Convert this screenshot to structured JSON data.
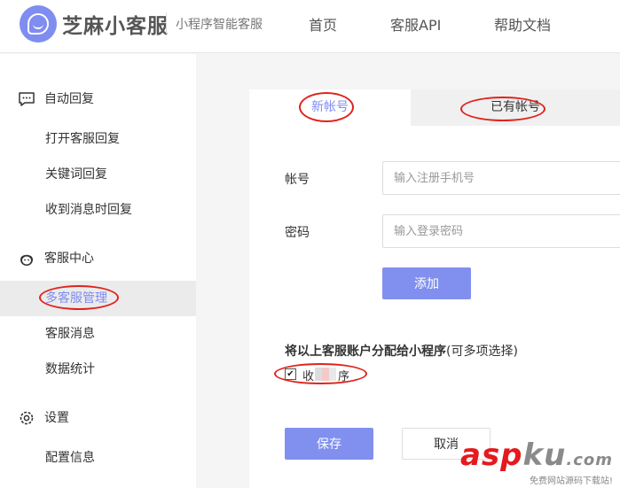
{
  "header": {
    "brand": "芝麻小客服",
    "subtitle": "小程序智能客服",
    "nav": [
      {
        "label": "首页"
      },
      {
        "label": "客服API"
      },
      {
        "label": "帮助文档"
      }
    ]
  },
  "sidebar": {
    "groups": [
      {
        "label": "自动回复",
        "icon": "chat-bubble-icon",
        "items": [
          {
            "label": "打开客服回复"
          },
          {
            "label": "关键词回复"
          },
          {
            "label": "收到消息时回复"
          }
        ]
      },
      {
        "label": "客服中心",
        "icon": "agent-avatar-icon",
        "items": [
          {
            "label": "多客服管理",
            "active": true
          },
          {
            "label": "客服消息"
          },
          {
            "label": "数据统计"
          }
        ]
      },
      {
        "label": "设置",
        "icon": "gear-icon",
        "items": [
          {
            "label": "配置信息"
          }
        ]
      }
    ]
  },
  "main": {
    "tabs": [
      {
        "label": "新帐号",
        "active": true
      },
      {
        "label": "已有帐号",
        "active": false
      }
    ],
    "form": {
      "account_label": "帐号",
      "account_placeholder": "输入注册手机号",
      "password_label": "密码",
      "password_placeholder": "输入登录密码",
      "add_label": "添加"
    },
    "assign": {
      "title_bold": "将以上客服账户分配给小程序",
      "title_hint": "(可多项选择)",
      "checkbox_checked": true,
      "checkbox_label_start": "收",
      "checkbox_label_end": "序"
    },
    "save_label": "保存",
    "cancel_label": "取消"
  },
  "watermark": {
    "main_a": "asp",
    "main_b": "ku",
    "main_c": ".com",
    "sub": "免费网站源码下载站!"
  },
  "colors": {
    "accent": "#7f8cf0",
    "annotation": "#e0231c"
  }
}
